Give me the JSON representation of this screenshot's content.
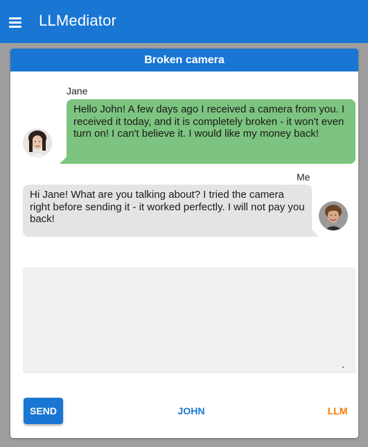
{
  "app": {
    "title": "LLMediator"
  },
  "chat": {
    "title": "Broken camera",
    "messages": [
      {
        "sender": "Jane",
        "text": "Hello John! A few days ago I received a camera from you. I received it today, and it is completely broken - it won't even turn on! I can't believe it. I would like my money back!",
        "bubble_color": "#7cc47f"
      },
      {
        "sender": "Me",
        "text": "Hi Jane! What are you talking about? I tried the camera right before sending it - it worked perfectly. I will not pay you back!",
        "bubble_color": "#e4e4e4"
      }
    ]
  },
  "input": {
    "value": "",
    "placeholder": ""
  },
  "actions": {
    "send_label": "SEND",
    "john_label": "JOHN",
    "llm_label": "LLM"
  },
  "colors": {
    "primary": "#1976d2",
    "accent": "#f57c00"
  },
  "icons": {
    "menu": "hamburger-menu-icon"
  }
}
